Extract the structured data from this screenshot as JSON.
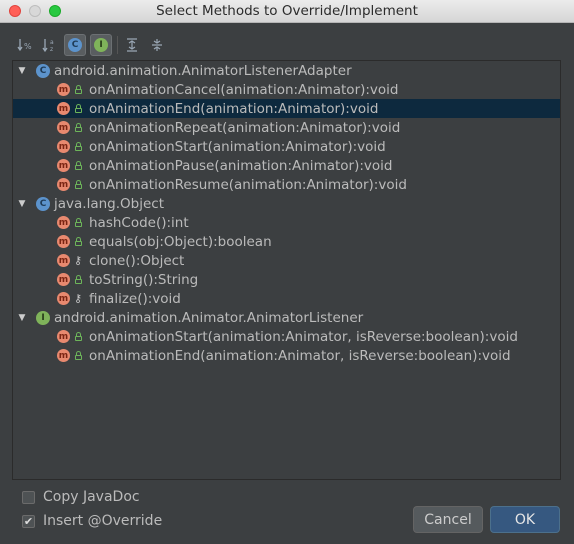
{
  "window": {
    "title": "Select Methods to Override/Implement"
  },
  "toolbar": {
    "buttons": [
      {
        "icon": "sort-by-visibility-icon",
        "glyph": "↓%"
      },
      {
        "icon": "sort-alphabetically-icon",
        "glyph": "↓ᵃ"
      },
      {
        "icon": "show-classes-icon",
        "glyph": "C"
      },
      {
        "icon": "show-interfaces-icon",
        "glyph": "I"
      },
      {
        "icon": "expand-all-icon",
        "glyph": "⇊"
      },
      {
        "icon": "collapse-all-icon",
        "glyph": "⇈"
      }
    ]
  },
  "tree": {
    "groups": [
      {
        "label": "android.animation.AnimatorListenerAdapter",
        "kind": "abstract-class",
        "icon_letter": "C",
        "methods": [
          {
            "label": "onAnimationCancel(animation:Animator):void",
            "visibility": "public",
            "selected": false
          },
          {
            "label": "onAnimationEnd(animation:Animator):void",
            "visibility": "public",
            "selected": true
          },
          {
            "label": "onAnimationRepeat(animation:Animator):void",
            "visibility": "public",
            "selected": false
          },
          {
            "label": "onAnimationStart(animation:Animator):void",
            "visibility": "public",
            "selected": false
          },
          {
            "label": "onAnimationPause(animation:Animator):void",
            "visibility": "public",
            "selected": false
          },
          {
            "label": "onAnimationResume(animation:Animator):void",
            "visibility": "public",
            "selected": false
          }
        ]
      },
      {
        "label": "java.lang.Object",
        "kind": "class",
        "icon_letter": "C",
        "methods": [
          {
            "label": "hashCode():int",
            "visibility": "public",
            "selected": false
          },
          {
            "label": "equals(obj:Object):boolean",
            "visibility": "public",
            "selected": false
          },
          {
            "label": "clone():Object",
            "visibility": "protected",
            "selected": false
          },
          {
            "label": "toString():String",
            "visibility": "public",
            "selected": false
          },
          {
            "label": "finalize():void",
            "visibility": "protected",
            "selected": false
          }
        ]
      },
      {
        "label": "android.animation.Animator.AnimatorListener",
        "kind": "interface",
        "icon_letter": "I",
        "methods": [
          {
            "label": "onAnimationStart(animation:Animator, isReverse:boolean):void",
            "visibility": "public",
            "selected": false
          },
          {
            "label": "onAnimationEnd(animation:Animator, isReverse:boolean):void",
            "visibility": "public",
            "selected": false
          }
        ]
      }
    ]
  },
  "options": {
    "copy_javadoc": {
      "label": "Copy JavaDoc",
      "checked": false
    },
    "insert_override": {
      "label": "Insert @Override",
      "checked": true
    }
  },
  "buttons": {
    "cancel": "Cancel",
    "ok": "OK"
  },
  "colors": {
    "selection": "#0d293e",
    "method_icon": "#e8896f",
    "class_icon": "#5c93cc",
    "interface_icon": "#7fb35a"
  }
}
